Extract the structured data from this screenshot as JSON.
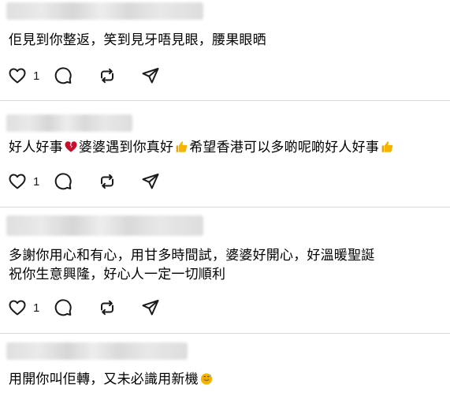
{
  "comments": [
    {
      "text": "佢見到你整返，笑到見牙唔見眼，腰果眼晒",
      "likes": "1"
    },
    {
      "text_parts": [
        "好人好事",
        "婆婆遇到你真好",
        "希望香港可以多啲呢啲好人好事"
      ],
      "likes": "1",
      "emoji": [
        "broken-heart-icon",
        "thumbs-up-icon",
        "thumbs-up-icon"
      ]
    },
    {
      "line1": "多謝你用心和有心，用甘多時間試，婆婆好開心，好溫暖聖誕",
      "line2": "祝你生意興隆，好心人一定一切順利",
      "likes": "1"
    },
    {
      "text": "用開你叫佢轉，又未必識用新機",
      "emoji": "grinning-sweat-icon"
    }
  ],
  "colors": {
    "text": "#000000",
    "divider": "#d9d9d9",
    "icon": "#1a1a1a",
    "emoji_heart": "#c8102e",
    "emoji_yellow": "#f4b400"
  }
}
